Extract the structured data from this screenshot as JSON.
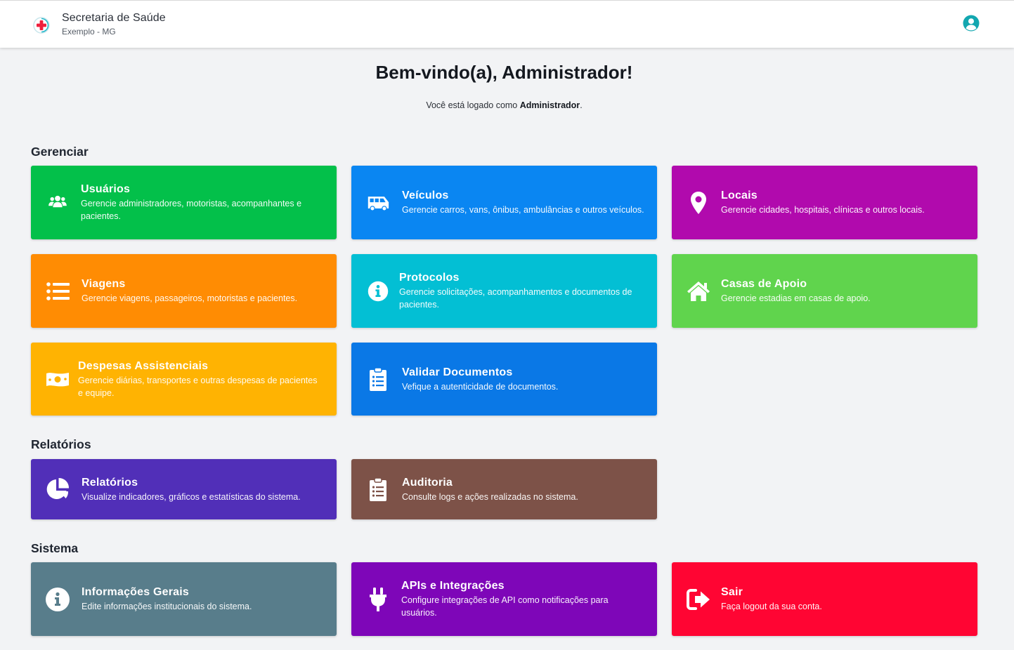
{
  "header": {
    "title": "Secretaria de Saúde",
    "subtitle": "Exemplo - MG",
    "logo_icon": "medical-cross-icon",
    "user_icon": "user-circle-icon"
  },
  "welcome": {
    "title": "Bem-vindo(a), Administrador!",
    "prefix": "Você está logado como",
    "role": "Administrador",
    "suffix": "."
  },
  "sections": {
    "gerenciar": {
      "title": "Gerenciar",
      "cards": [
        {
          "title": "Usuários",
          "desc": "Gerencie administradores, motoristas, acompanhantes e pacientes.",
          "icon": "users-icon",
          "color": "#03c04a"
        },
        {
          "title": "Veículos",
          "desc": "Gerencie carros, vans, ônibus, ambulâncias e outros veículos.",
          "icon": "van-icon",
          "color": "#0a86f2"
        },
        {
          "title": "Locais",
          "desc": "Gerencie cidades, hospitais, clínicas e outros locais.",
          "icon": "map-pin-icon",
          "color": "#b10aad"
        },
        {
          "title": "Viagens",
          "desc": "Gerencie viagens, passageiros, motoristas e pacientes.",
          "icon": "list-icon",
          "color": "#ff8c03"
        },
        {
          "title": "Protocolos",
          "desc": "Gerencie solicitações, acompanhamentos e documentos de pacientes.",
          "icon": "info-circle-icon",
          "color": "#03bfd4"
        },
        {
          "title": "Casas de Apoio",
          "desc": "Gerencie estadias em casas de apoio.",
          "icon": "home-icon",
          "color": "#60d44d"
        },
        {
          "title": "Despesas Assistenciais",
          "desc": "Gerencie diárias, transportes e outras despesas de pacientes e equipe.",
          "icon": "money-bill-icon",
          "color": "#ffb302"
        },
        {
          "title": "Validar Documentos",
          "desc": "Vefique a autenticidade de documentos.",
          "icon": "clipboard-list-icon",
          "color": "#0a78e6"
        }
      ]
    },
    "relatorios": {
      "title": "Relatórios",
      "cards": [
        {
          "title": "Relatórios",
          "desc": "Visualize indicadores, gráficos e estatísticas do sistema.",
          "icon": "pie-chart-icon",
          "color": "#512fb8"
        },
        {
          "title": "Auditoria",
          "desc": "Consulte logs e ações realizadas no sistema.",
          "icon": "clipboard-list-icon",
          "color": "#7d5248"
        }
      ]
    },
    "sistema": {
      "title": "Sistema",
      "cards": [
        {
          "title": "Informações Gerais",
          "desc": "Edite informações institucionais do sistema.",
          "icon": "info-circle-icon",
          "color": "#587d8b"
        },
        {
          "title": "APIs e Integrações",
          "desc": "Configure integrações de API como notificações para usuários.",
          "icon": "plug-icon",
          "color": "#7e06b8"
        },
        {
          "title": "Sair",
          "desc": "Faça logout da sua conta.",
          "icon": "sign-out-icon",
          "color": "#ff0533"
        }
      ]
    }
  }
}
